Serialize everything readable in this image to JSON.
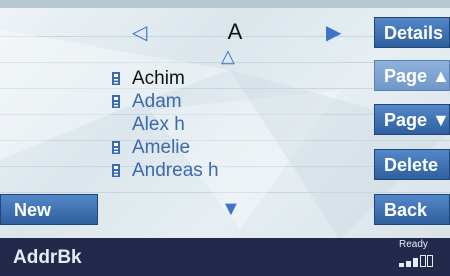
{
  "navigator": {
    "letter": "A",
    "prev_icon": "triangle-left-icon",
    "next_icon": "triangle-right-icon",
    "scroll_up_icon": "triangle-up-outline-icon",
    "scroll_down_icon": "triangle-down-filled-icon"
  },
  "contacts": [
    {
      "name": "Achim",
      "has_phone_icon": true,
      "selected": true
    },
    {
      "name": "Adam",
      "has_phone_icon": true,
      "selected": false
    },
    {
      "name": "Alex h",
      "has_phone_icon": false,
      "selected": false
    },
    {
      "name": "Amelie",
      "has_phone_icon": true,
      "selected": false
    },
    {
      "name": "Andreas h",
      "has_phone_icon": true,
      "selected": false
    }
  ],
  "buttons": {
    "details": "Details",
    "page_up": "Page ▲",
    "page_down": "Page ▼",
    "delete": "Delete",
    "back": "Back",
    "new": "New"
  },
  "status_bar": {
    "title": "AddrBk",
    "state": "Ready",
    "signal_icon": "signal-strength-icon"
  },
  "colors": {
    "accent": "#3b74c8",
    "button_blue": "#2f5f9e",
    "button_light": "#7fa4d2",
    "status_bg": "#23294a"
  }
}
